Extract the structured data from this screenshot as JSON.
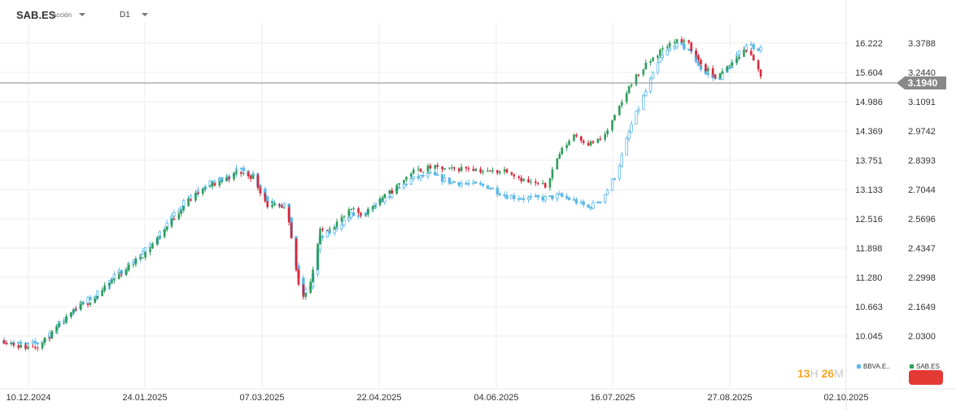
{
  "header": {
    "symbol": "SAB.ES",
    "instrument_type": "Acción",
    "timeframe": "D1"
  },
  "timer": {
    "hours": "13",
    "hours_unit": "H",
    "minutes": "26",
    "minutes_unit": "M"
  },
  "colors": {
    "up": "#2e9d5b",
    "down": "#d8283c",
    "overlay": "#5bb8e8",
    "grid": "#eeeeee",
    "price_line": "#888888",
    "price_tag": "#888888"
  },
  "chart_data": {
    "type": "candlestick",
    "left_axis_label_name": "SAB.ES",
    "right_axis_label_name": "BBVA.E..",
    "x_tick_labels": [
      "10.12.2024",
      "24.01.2025",
      "07.03.2025",
      "22.04.2025",
      "04.06.2025",
      "16.07.2025",
      "27.08.2025",
      "02.10.2025"
    ],
    "x_range": [
      "2024-12-10",
      "2025-10-08"
    ],
    "y_left_ticks": [
      10.045,
      10.663,
      11.28,
      11.898,
      12.516,
      13.133,
      13.751,
      14.369,
      14.986,
      15.604,
      16.222
    ],
    "y_left_tick_labels": [
      "10.045",
      "10.663",
      "11.280",
      "11.898",
      "12.516",
      "13.133",
      "13.751",
      "14.369",
      "14.986",
      "15.604",
      "16.222"
    ],
    "y_right_tick_labels": [
      "2.0300",
      "2.1649",
      "2.2998",
      "2.4347",
      "2.5696",
      "2.7044",
      "2.8393",
      "2.9742",
      "3.1091",
      "3.2440",
      "3.3788"
    ],
    "y_left_range": [
      9.55,
      16.65
    ],
    "current_price_label": "3.1940",
    "current_price": 3.194,
    "legend": [
      {
        "name": "BBVA.E..",
        "color": "#5bb8e8"
      },
      {
        "name": "SAB.ES",
        "color": "#2e9d5b"
      }
    ],
    "anchors_sab_close": [
      [
        0,
        9.95
      ],
      [
        8,
        9.8
      ],
      [
        15,
        9.85
      ],
      [
        22,
        10.2
      ],
      [
        30,
        10.6
      ],
      [
        38,
        10.85
      ],
      [
        45,
        11.2
      ],
      [
        52,
        11.5
      ],
      [
        60,
        11.85
      ],
      [
        68,
        12.35
      ],
      [
        75,
        12.8
      ],
      [
        82,
        13.1
      ],
      [
        90,
        13.3
      ],
      [
        98,
        13.5
      ],
      [
        104,
        13.4
      ],
      [
        110,
        12.8
      ],
      [
        118,
        12.7
      ],
      [
        124,
        10.8
      ],
      [
        128,
        11.2
      ],
      [
        132,
        12.25
      ],
      [
        138,
        12.4
      ],
      [
        145,
        12.7
      ],
      [
        150,
        12.6
      ],
      [
        156,
        12.9
      ],
      [
        162,
        13.1
      ],
      [
        170,
        13.5
      ],
      [
        178,
        13.6
      ],
      [
        186,
        13.55
      ],
      [
        194,
        13.6
      ],
      [
        202,
        13.5
      ],
      [
        210,
        13.55
      ],
      [
        218,
        13.3
      ],
      [
        226,
        13.2
      ],
      [
        232,
        13.9
      ],
      [
        238,
        14.3
      ],
      [
        244,
        14.1
      ],
      [
        250,
        14.2
      ],
      [
        256,
        14.75
      ],
      [
        262,
        15.4
      ],
      [
        268,
        15.75
      ],
      [
        274,
        16.05
      ],
      [
        280,
        16.3
      ],
      [
        286,
        16.2
      ],
      [
        292,
        15.7
      ],
      [
        298,
        15.5
      ],
      [
        304,
        15.8
      ],
      [
        310,
        16.1
      ],
      [
        316,
        15.55
      ]
    ],
    "anchors_bbva_close": [
      [
        0,
        9.95
      ],
      [
        8,
        9.85
      ],
      [
        15,
        9.9
      ],
      [
        22,
        10.25
      ],
      [
        30,
        10.65
      ],
      [
        38,
        10.9
      ],
      [
        45,
        11.25
      ],
      [
        52,
        11.55
      ],
      [
        60,
        11.9
      ],
      [
        68,
        12.4
      ],
      [
        75,
        12.85
      ],
      [
        82,
        13.15
      ],
      [
        90,
        13.35
      ],
      [
        98,
        13.55
      ],
      [
        104,
        13.45
      ],
      [
        110,
        12.9
      ],
      [
        118,
        12.8
      ],
      [
        124,
        10.9
      ],
      [
        128,
        11.1
      ],
      [
        132,
        12.1
      ],
      [
        138,
        12.3
      ],
      [
        145,
        12.6
      ],
      [
        150,
        12.55
      ],
      [
        156,
        12.85
      ],
      [
        162,
        13.05
      ],
      [
        170,
        13.35
      ],
      [
        178,
        13.45
      ],
      [
        186,
        13.3
      ],
      [
        194,
        13.25
      ],
      [
        202,
        13.2
      ],
      [
        210,
        13.0
      ],
      [
        218,
        12.95
      ],
      [
        226,
        12.95
      ],
      [
        232,
        13.0
      ],
      [
        238,
        12.9
      ],
      [
        244,
        12.75
      ],
      [
        250,
        12.95
      ],
      [
        256,
        13.5
      ],
      [
        262,
        14.5
      ],
      [
        268,
        15.2
      ],
      [
        274,
        15.9
      ],
      [
        280,
        16.2
      ],
      [
        286,
        16.1
      ],
      [
        292,
        15.6
      ],
      [
        298,
        15.45
      ],
      [
        304,
        15.8
      ],
      [
        310,
        16.2
      ],
      [
        316,
        16.1
      ]
    ],
    "candle_days": 317
  }
}
